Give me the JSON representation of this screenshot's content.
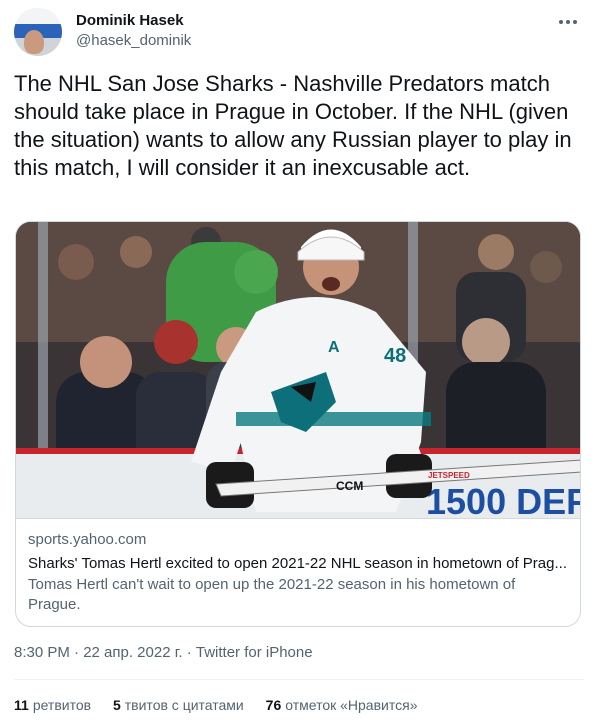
{
  "author": {
    "name": "Dominik Hasek",
    "handle": "@hasek_dominik"
  },
  "tweet": {
    "text": "The NHL San Jose Sharks - Nashville Predators match should take place in Prague in October. If the NHL (given the situation) wants to allow any Russian player to play in this match, I will consider it an inexcusable act."
  },
  "card": {
    "domain": "sports.yahoo.com",
    "title": "Sharks' Tomas Hertl excited to open 2021-22 NHL season in hometown of Prag...",
    "description": "Tomas Hertl can't wait to open up the 2021-22 season in his hometown of Prague.",
    "image_jersey_number": "48",
    "image_captain_letter": "A",
    "image_stick_text": "CCM",
    "image_stick_text2": "JETSPEED",
    "image_board_text": "1500 DEF"
  },
  "meta": {
    "timestamp": "8:30 PM · 22 апр. 2022 г. · Twitter for iPhone"
  },
  "stats": {
    "retweets_count": "11",
    "retweets_label": "ретвитов",
    "quotes_count": "5",
    "quotes_label": "твитов с цитатами",
    "likes_count": "76",
    "likes_label": "отметок «Нравится»"
  },
  "colors": {
    "text_primary": "#0f1419",
    "text_secondary": "#536471",
    "border": "#cfd9de",
    "sharks_teal": "#006d75"
  },
  "icons": {
    "more": "more-horizontal-icon"
  }
}
